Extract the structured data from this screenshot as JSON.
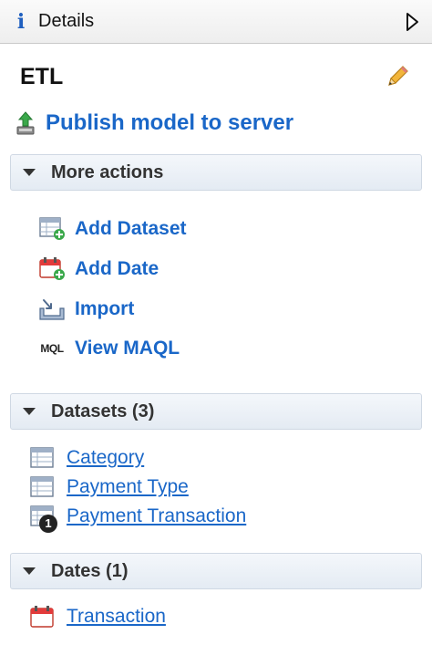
{
  "titlebar": {
    "title": "Details",
    "info_icon": "i",
    "collapse_icon": "triangle-right-icon"
  },
  "model": {
    "title": "ETL",
    "edit_icon": "pencil-icon"
  },
  "publish": {
    "label": "Publish model to server",
    "icon": "upload-icon"
  },
  "more_actions": {
    "header": "More actions",
    "items": [
      {
        "label": "Add Dataset",
        "icon": "add-dataset-icon"
      },
      {
        "label": "Add Date",
        "icon": "add-date-icon"
      },
      {
        "label": "Import",
        "icon": "import-icon"
      },
      {
        "label": "View MAQL",
        "icon": "maql-icon",
        "glyph": "MQL"
      }
    ]
  },
  "datasets": {
    "header": "Datasets (3)",
    "items": [
      {
        "label": "Category",
        "icon": "table-icon"
      },
      {
        "label": "Payment Type",
        "icon": "table-icon"
      },
      {
        "label": "Payment Transaction",
        "icon": "table-badge-icon",
        "badge": "1"
      }
    ]
  },
  "dates": {
    "header": "Dates (1)",
    "items": [
      {
        "label": "Transaction",
        "icon": "calendar-icon"
      }
    ]
  },
  "colors": {
    "link": "#1a67c8",
    "header_bg": "#e4ebf3",
    "calendar_red": "#e23b3b",
    "plus_green": "#3aa84a"
  }
}
